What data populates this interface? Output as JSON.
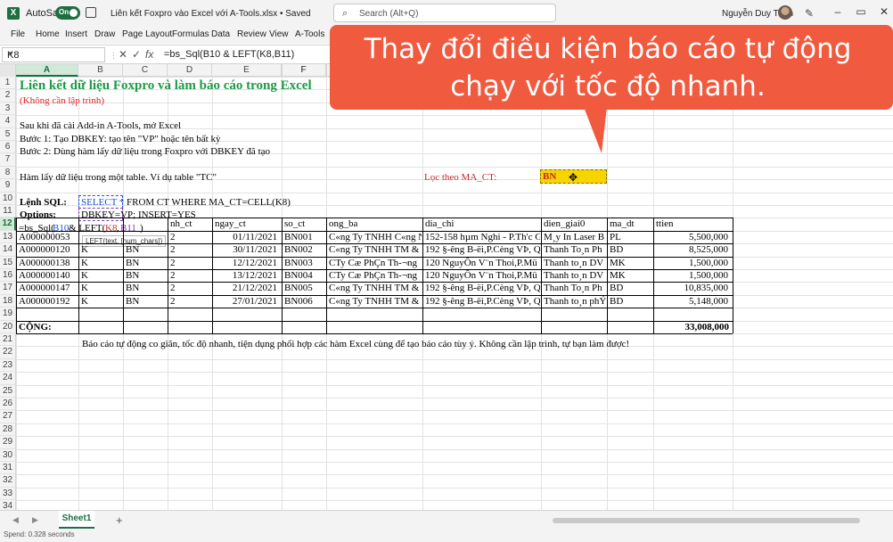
{
  "titlebar": {
    "autosave_label": "AutoSave",
    "autosave_state": "On",
    "document_title": "Liên kết Foxpro vào Excel với A-Tools.xlsx • Saved",
    "search_placeholder": "Search (Alt+Q)",
    "user_name": "Nguyễn Duy Tuân",
    "minimize": "–",
    "restore": "▭",
    "close": "✕"
  },
  "menu": [
    "File",
    "Home",
    "Insert",
    "Draw",
    "Page Layout",
    "Formulas",
    "Data",
    "Review",
    "View",
    "A-Tools"
  ],
  "formula_bar": {
    "name_box": "K8",
    "cancel": "✕",
    "enter": "✓",
    "fx": "fx",
    "formula": "=bs_Sql(B10 & LEFT(K8,B11)"
  },
  "columns": [
    "A",
    "B",
    "C",
    "D",
    "E",
    "F",
    "G"
  ],
  "row_numbers": [
    "1",
    "2",
    "3",
    "4",
    "5",
    "6",
    "7",
    "8",
    "9",
    "10",
    "11",
    "12",
    "13",
    "14",
    "15",
    "16",
    "17",
    "18",
    "19",
    "20",
    "21",
    "22",
    "23",
    "24",
    "25",
    "26",
    "27",
    "28",
    "29",
    "30",
    "31",
    "32",
    "33",
    "34",
    "35"
  ],
  "sheet": {
    "title": "Liên kết dữ liệu Foxpro và làm báo cáo trong Excel",
    "subtitle": "(Không cần lập trình)",
    "line4": "Sau khi đã cài Add-in A-Tools, mở Excel",
    "line5": "Bước 1: Tạo DBKEY: tạo tên \"VP\" hoặc tên bất kỳ",
    "line6": "Bước 2: Dùng hàm lấy dữ liệu trong Foxpro với DBKEY đã tạo",
    "line8": "Hàm lấy dữ liệu trong một table. Ví dụ table \"TC\"",
    "filter_label": "Lọc theo MA_CT:",
    "filter_value": "BN",
    "sql_label": "Lệnh SQL:",
    "sql_select": "SELECT *",
    "sql_rest": "FROM CT WHERE MA_CT=CELL(K8)",
    "options_label": "Options:",
    "options_value": "DBKEY=VP; INSERT=YES",
    "editing_prefix": "=bs_Sql(",
    "editing_b10": "B10",
    "editing_mid": " & LEFT(",
    "editing_k8": "K8",
    "editing_comma": ",",
    "editing_b11": "B11",
    "editing_end": ")",
    "tooltip": "LEFT(text, [num_chars])",
    "headers": [
      "",
      "",
      "",
      "nh_ct",
      "ngay_ct",
      "so_ct",
      "ong_ba",
      "dia_chi",
      "dien_giai0",
      "ma_dt",
      "ttien"
    ],
    "rows": [
      [
        "A000000053",
        "",
        "",
        "2",
        "01/11/2021",
        "BN001",
        "C«ng Ty TNHH C«ng N",
        "152-158 hµm Nghi - P.Th'c G",
        "M¸y In Laser B",
        "PL",
        "5,500,000"
      ],
      [
        "A000000120",
        "K",
        "BN",
        "2",
        "30/11/2021",
        "BN002",
        "C«ng Ty TNHH TM &",
        "192 §-êng B-ëi,P.Cèng VÞ, Q.",
        "Thanh To¸n Ph",
        "BD",
        "8,525,000"
      ],
      [
        "A000000138",
        "K",
        "BN",
        "2",
        "12/12/2021",
        "BN003",
        "CTy Cæ PhÇn Th-¬ng",
        "120 NguyÔn V¨n Thoi,P.Mü",
        "Thanh to¸n DV",
        "MK",
        "1,500,000"
      ],
      [
        "A000000140",
        "K",
        "BN",
        "2",
        "13/12/2021",
        "BN004",
        "CTy Cæ PhÇn Th-¬ng",
        "120 NguyÔn V¨n Thoi,P.Mü",
        "Thanh to¸n DV",
        "MK",
        "1,500,000"
      ],
      [
        "A000000147",
        "K",
        "BN",
        "2",
        "21/12/2021",
        "BN005",
        "C«ng Ty TNHH TM &",
        "192 §-êng B-ëi,P.Cèng VÞ, Q.",
        "Thanh To¸n Ph",
        "BD",
        "10,835,000"
      ],
      [
        "A000000192",
        "K",
        "BN",
        "2",
        "27/01/2021",
        "BN006",
        "C«ng Ty TNHH TM &",
        "192 §-êng B-ëi,P.Cèng VÞ, Q.",
        "Thanh to¸n phÝ",
        "BD",
        "5,148,000"
      ]
    ],
    "total_label": "CỘNG:",
    "total_value": "33,008,000",
    "footer_note": "Báo cáo tự động co giãn, tốc độ nhanh, tiện dụng phối hợp các hàm Excel cùng để tạo báo cáo tùy ý. Không cần lập trình, tự bạn làm được!"
  },
  "callout": {
    "text": "Thay đổi điều kiện báo cáo tự động chạy với tốc độ nhanh."
  },
  "sheet_tabs": {
    "active": "Sheet1",
    "add": "+"
  },
  "status": {
    "text": "Spend: 0.328 seconds"
  },
  "colors": {
    "excel_green": "#1d6f42",
    "title_green": "#1e9a47",
    "subtitle_red": "#e02020",
    "filter_red": "#c62828",
    "highlight_yellow": "#f5d400",
    "callout_orange": "#f05a3f",
    "ref_blue": "#1f4fd6",
    "ref_red": "#c0392b",
    "ref_purple": "#7b3fb4"
  }
}
